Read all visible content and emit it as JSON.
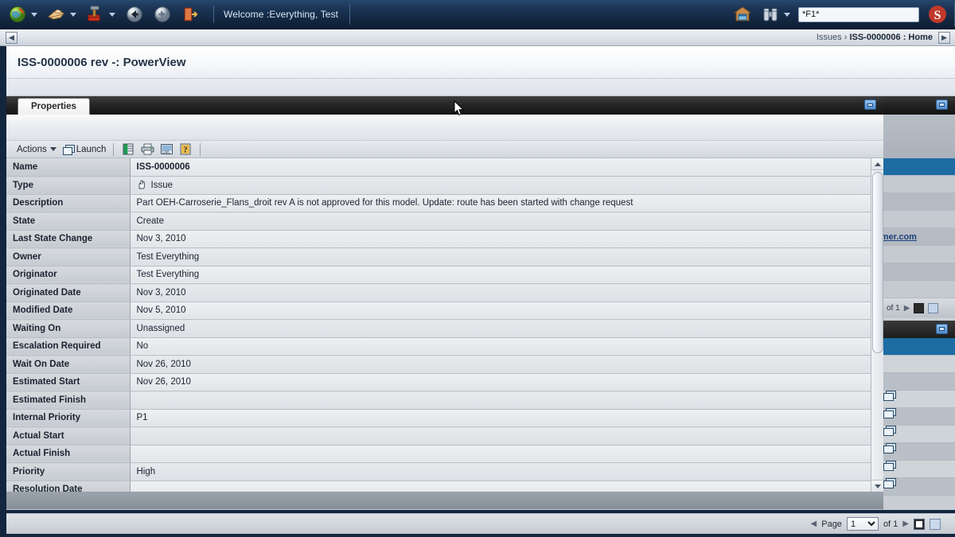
{
  "topbar": {
    "icons": [
      {
        "name": "home-globe-icon",
        "glyph": "🌐"
      },
      {
        "name": "collaboration-icon",
        "glyph": "✋"
      },
      {
        "name": "tools-hammer-icon",
        "glyph": "🔨"
      }
    ],
    "back_icon": "back-arrow-icon",
    "forward_icon": "forward-arrow-icon",
    "exit_icon": "exit-door-icon",
    "welcome_text": "Welcome :Everything, Test",
    "home_icon": "home-house-icon",
    "binoculars_icon": "binoculars-search-icon",
    "search_value": "*F1*",
    "search_placeholder": "",
    "brand_logo": "s-brand-logo"
  },
  "breadcrumb": {
    "back_button": "◀",
    "forward_button": "▶",
    "prefix": "Issues › ",
    "current": "ISS-0000006 : Home"
  },
  "page": {
    "title": "ISS-0000006 rev -: PowerView"
  },
  "panel": {
    "tab_label": "Properties",
    "window_button": "restore-window-icon",
    "toolbar": {
      "actions_label": "Actions",
      "launch_label": "Launch",
      "excel_icon": "export-excel-icon",
      "print_icon": "print-icon",
      "url_icon": "url-link-icon",
      "help_icon": "help-question-icon"
    }
  },
  "properties": {
    "rows": [
      {
        "label": "Name",
        "value": "ISS-0000006",
        "bold": true
      },
      {
        "label": "Type",
        "value": "Issue",
        "icon": "issue-type-icon"
      },
      {
        "label": "Description",
        "value": "Part OEH-Carroserie_Flans_droit rev A is not approved for this model. Update: route has been started with change request"
      },
      {
        "label": "State",
        "value": "Create"
      },
      {
        "label": "Last State Change",
        "value": "Nov 3, 2010"
      },
      {
        "label": "Owner",
        "value": "Test Everything"
      },
      {
        "label": "Originator",
        "value": "Test Everything"
      },
      {
        "label": "Originated Date",
        "value": "Nov 3, 2010"
      },
      {
        "label": "Modified Date",
        "value": "Nov 5, 2010"
      },
      {
        "label": "Waiting On",
        "value": "Unassigned"
      },
      {
        "label": "Escalation Required",
        "value": "No"
      },
      {
        "label": "Wait On Date",
        "value": "Nov 26, 2010"
      },
      {
        "label": "Estimated Start",
        "value": "Nov 26, 2010"
      },
      {
        "label": "Estimated Finish",
        "value": ""
      },
      {
        "label": "Internal Priority",
        "value": "P1"
      },
      {
        "label": "Actual Start",
        "value": ""
      },
      {
        "label": "Actual Finish",
        "value": ""
      },
      {
        "label": "Priority",
        "value": "High"
      },
      {
        "label": "Resolution Date",
        "value": ""
      }
    ]
  },
  "background_panel": {
    "window_button": "restore-window-icon",
    "link_text": "omer.com",
    "pager_of": "of 1",
    "pager_next": "▶",
    "launch_icons_count": 6
  },
  "bottom_pager": {
    "prev": "◀",
    "page_label": "Page",
    "page_value": "1",
    "page_options": [
      "1"
    ],
    "of_label": "of 1",
    "next": "▶",
    "view_icon_1": "single-view-icon",
    "view_icon_2": "split-view-icon"
  },
  "colors": {
    "chrome_dark": "#12263f",
    "accent_blue": "#1d6ca4",
    "tab_dark": "#262626",
    "link": "#1a3f7a"
  }
}
